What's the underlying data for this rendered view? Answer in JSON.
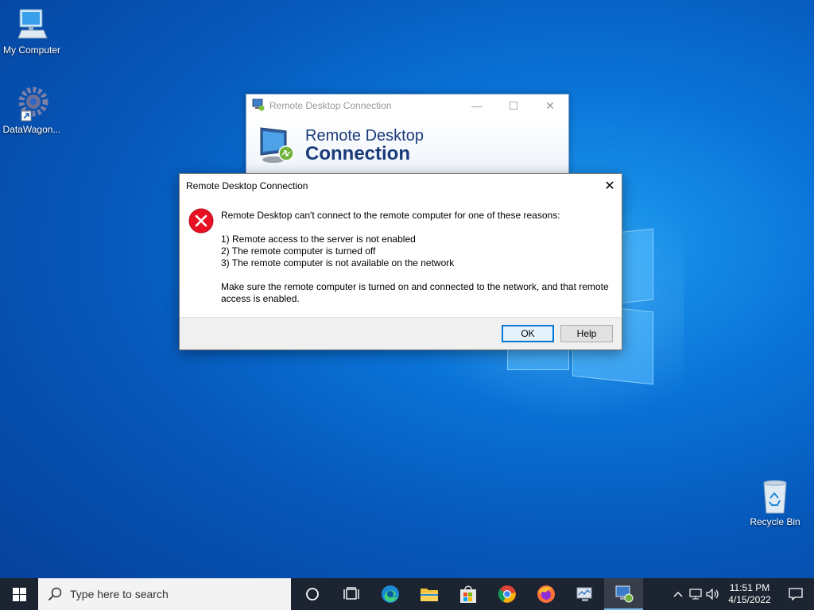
{
  "desktop": {
    "icons": [
      {
        "label": "My Computer"
      },
      {
        "label": "DataWagon..."
      },
      {
        "label": "Recycle Bin"
      }
    ]
  },
  "rdc_window": {
    "title": "Remote Desktop Connection",
    "banner_line1": "Remote Desktop",
    "banner_line2": "Connection"
  },
  "error_dialog": {
    "title": "Remote Desktop Connection",
    "message_intro": "Remote Desktop can't connect to the remote computer for one of these reasons:",
    "reasons": [
      "1) Remote access to the server is not enabled",
      "2) The remote computer is turned off",
      "3) The remote computer is not available on the network"
    ],
    "message_outro": "Make sure the remote computer is turned on and connected to the network, and that remote access is enabled.",
    "ok_label": "OK",
    "help_label": "Help"
  },
  "taskbar": {
    "search_placeholder": "Type here to search",
    "time": "11:51 PM",
    "date": "4/15/2022",
    "pinned": [
      "cortana",
      "task-view",
      "edge",
      "file-explorer",
      "store",
      "chrome",
      "firefox",
      "server-manager",
      "remote-desktop"
    ]
  },
  "colors": {
    "accent": "#0078d7",
    "error_red": "#e81123",
    "taskbar": "#1c2431"
  }
}
